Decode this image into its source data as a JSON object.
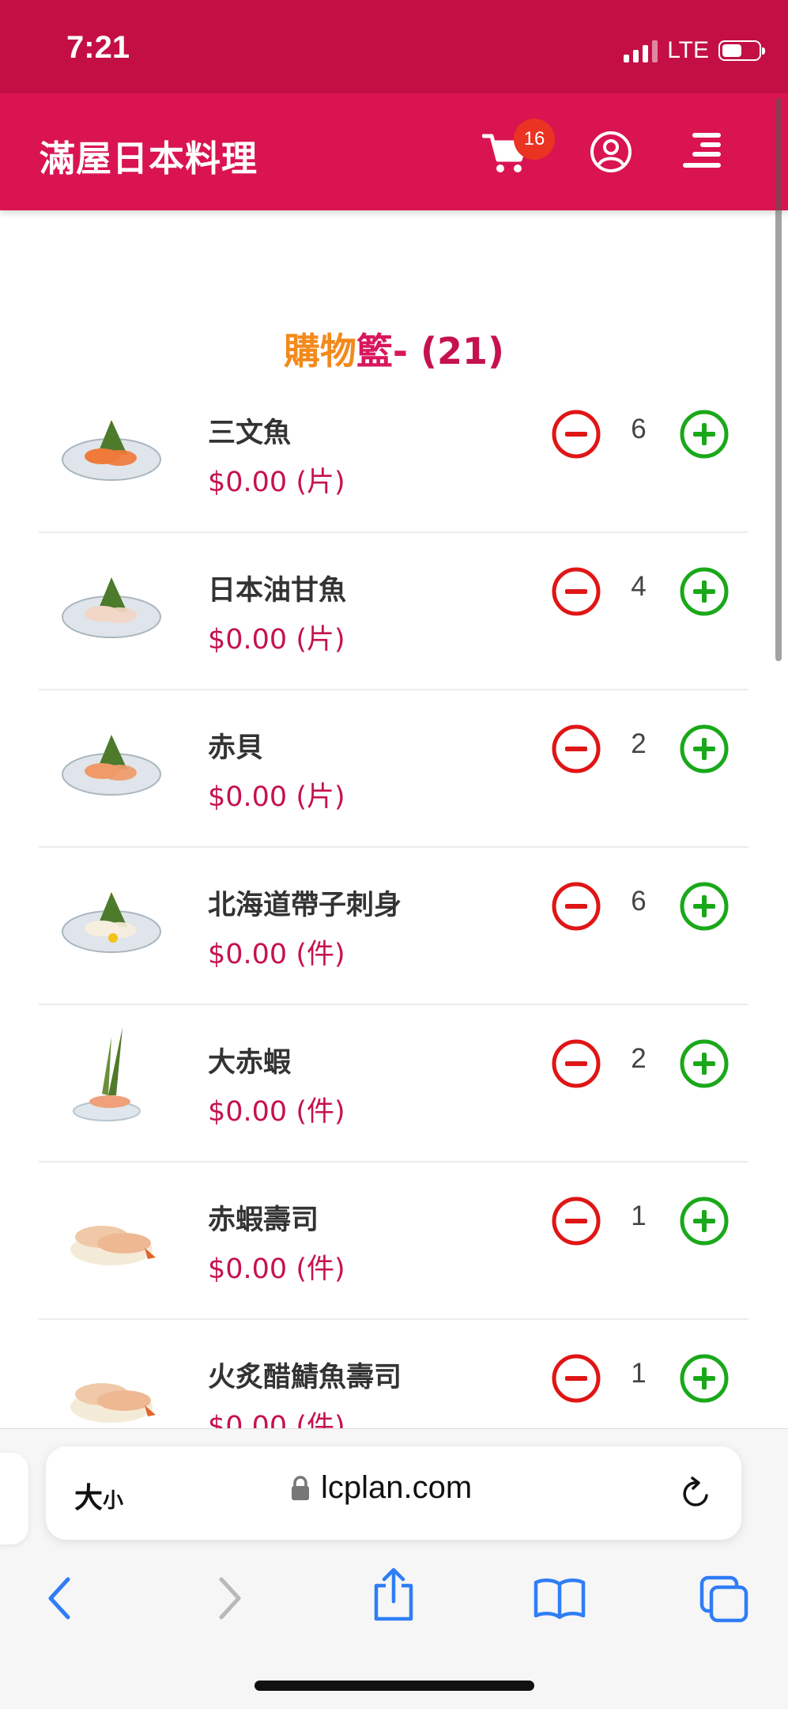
{
  "status_bar": {
    "time": "7:21",
    "network": "LTE"
  },
  "header": {
    "title": "滿屋日本料理",
    "cart_count": "16"
  },
  "cart": {
    "heading_part1": "購物",
    "heading_part2": "籃- ",
    "heading_count": "(21)",
    "items": [
      {
        "name": "三文魚",
        "price": "$0.00 (片)",
        "qty": "6"
      },
      {
        "name": "日本油甘魚",
        "price": "$0.00 (片)",
        "qty": "4"
      },
      {
        "name": "赤貝",
        "price": "$0.00 (片)",
        "qty": "2"
      },
      {
        "name": "北海道帶子刺身",
        "price": "$0.00 (件)",
        "qty": "6"
      },
      {
        "name": "大赤蝦",
        "price": "$0.00 (件)",
        "qty": "2"
      },
      {
        "name": "赤蝦壽司",
        "price": "$0.00 (件)",
        "qty": "1"
      },
      {
        "name": "火炙醋鯖魚壽司",
        "price": "$0.00 (件)",
        "qty": "1"
      }
    ]
  },
  "browser": {
    "text_size_big": "大",
    "text_size_small": "小",
    "url": "lcplan.com"
  },
  "colors": {
    "status_bg": "#c30f44",
    "header_bg": "#da1450",
    "price": "#c5124f",
    "minus": "#e01515",
    "plus": "#1aa81a",
    "badge": "#ea3322",
    "heading_orange": "#f28a1c",
    "ios_blue": "#2f7df6"
  },
  "icons": {
    "cart": "shopping-cart-icon",
    "user": "user-circle-icon",
    "menu": "menu-icon",
    "minus": "minus-circle-icon",
    "plus": "plus-circle-icon",
    "lock": "lock-icon",
    "reload": "reload-icon",
    "back": "chevron-left-icon",
    "forward": "chevron-right-icon",
    "share": "share-icon",
    "bookmarks": "book-icon",
    "tabs": "tabs-icon"
  }
}
